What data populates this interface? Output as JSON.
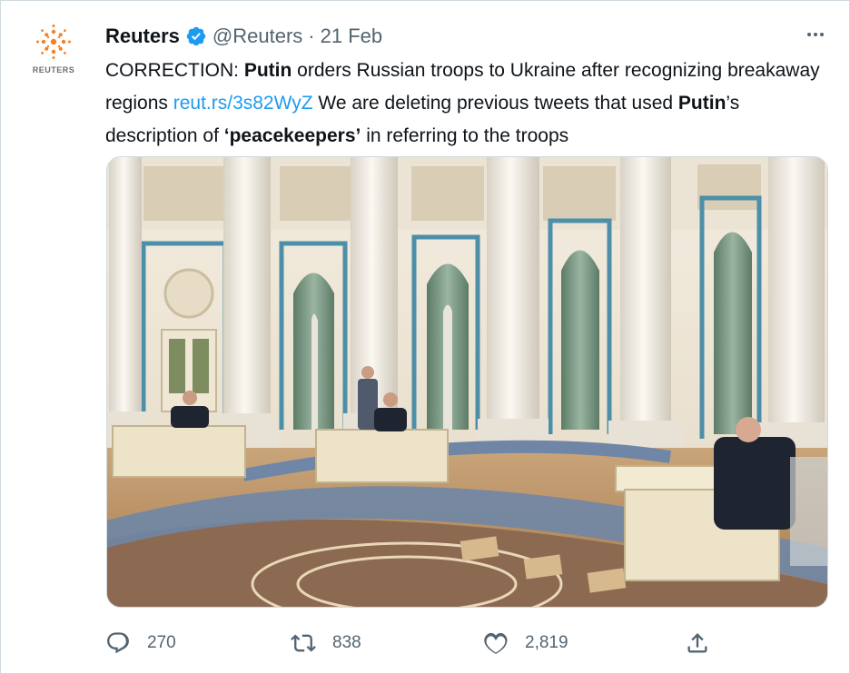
{
  "account": {
    "name": "Reuters",
    "handle": "@Reuters",
    "separator": "·",
    "date": "21 Feb",
    "logo_word": "REUTERS",
    "brand_color": "#f58025",
    "verified_color": "#1d9bf0"
  },
  "tweet": {
    "t1": "CORRECTION: ",
    "b1": "Putin",
    "t2": " orders Russian troops to Ukraine after recognizing breakaway regions ",
    "link": "reut.rs/3s82WyZ",
    "t3": " We are deleting previous tweets that used ",
    "b2": "Putin",
    "t4": "’s description of ",
    "b3": "‘peacekeepers’",
    "t5": " in referring to the troops"
  },
  "actions": {
    "replies": "270",
    "retweets": "838",
    "likes": "2,819"
  },
  "icons": {
    "reply": "reply-icon",
    "retweet": "retweet-icon",
    "like": "heart-icon",
    "share": "share-icon",
    "more": "more-icon",
    "verified": "verified-badge-icon"
  },
  "colors": {
    "text": "#0f1419",
    "secondary": "#536471",
    "link": "#1d9bf0",
    "border": "#cfd9de"
  }
}
